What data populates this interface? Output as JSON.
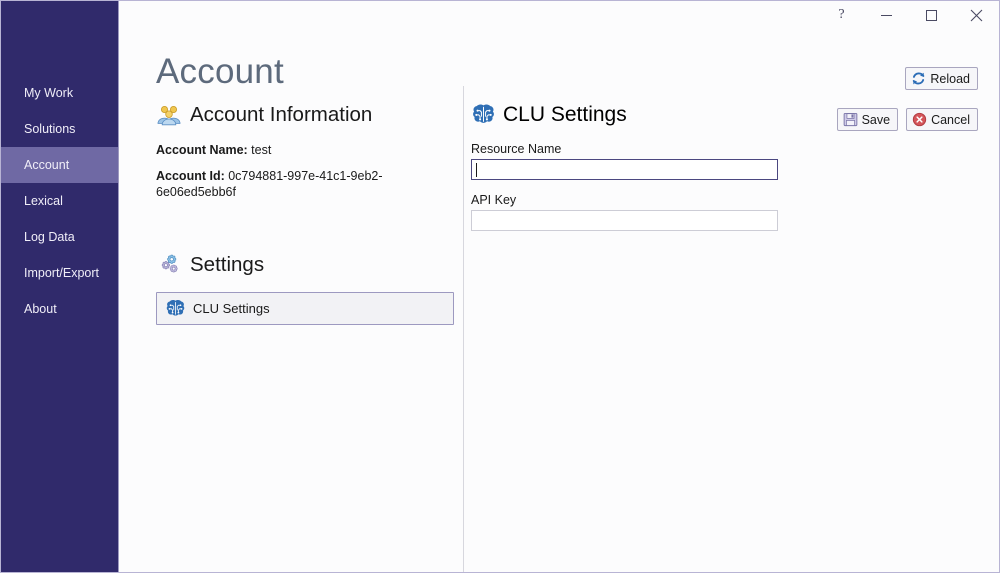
{
  "window": {
    "titlebar": {
      "help_label": "?",
      "minimize_label": "Minimize",
      "maximize_label": "Maximize",
      "close_label": "Close"
    }
  },
  "sidebar": {
    "items": [
      {
        "label": "My Work",
        "selected": false
      },
      {
        "label": "Solutions",
        "selected": false
      },
      {
        "label": "Account",
        "selected": true
      },
      {
        "label": "Lexical",
        "selected": false
      },
      {
        "label": "Log Data",
        "selected": false
      },
      {
        "label": "Import/Export",
        "selected": false
      },
      {
        "label": "About",
        "selected": false
      }
    ]
  },
  "main": {
    "page_title": "Account",
    "toolbar": {
      "reload_label": "Reload",
      "save_label": "Save",
      "cancel_label": "Cancel"
    },
    "account_information": {
      "heading": "Account Information",
      "icon": "people-group-icon",
      "account_name_label": "Account Name:",
      "account_name_value": "test",
      "account_id_label": "Account Id:",
      "account_id_value": "0c794881-997e-41c1-9eb2-6e06ed5ebb6f"
    },
    "settings": {
      "heading": "Settings",
      "icon": "gears-icon",
      "items": [
        {
          "label": "CLU Settings",
          "icon": "brain-circuit-icon",
          "selected": true
        }
      ]
    },
    "clu_panel": {
      "heading": "CLU Settings",
      "icon": "brain-circuit-icon",
      "fields": [
        {
          "label": "Resource Name",
          "value": "",
          "placeholder": "",
          "focused": true
        },
        {
          "label": "API Key",
          "value": "",
          "placeholder": "",
          "focused": false
        }
      ]
    }
  },
  "colors": {
    "sidebar_bg": "#302a6b",
    "sidebar_selected": "#6f69a4",
    "accent_blue": "#2b6cb6",
    "cancel_red": "#d4555a",
    "title_text": "#5d6a7c",
    "content_bg": "#fcfcfd"
  }
}
